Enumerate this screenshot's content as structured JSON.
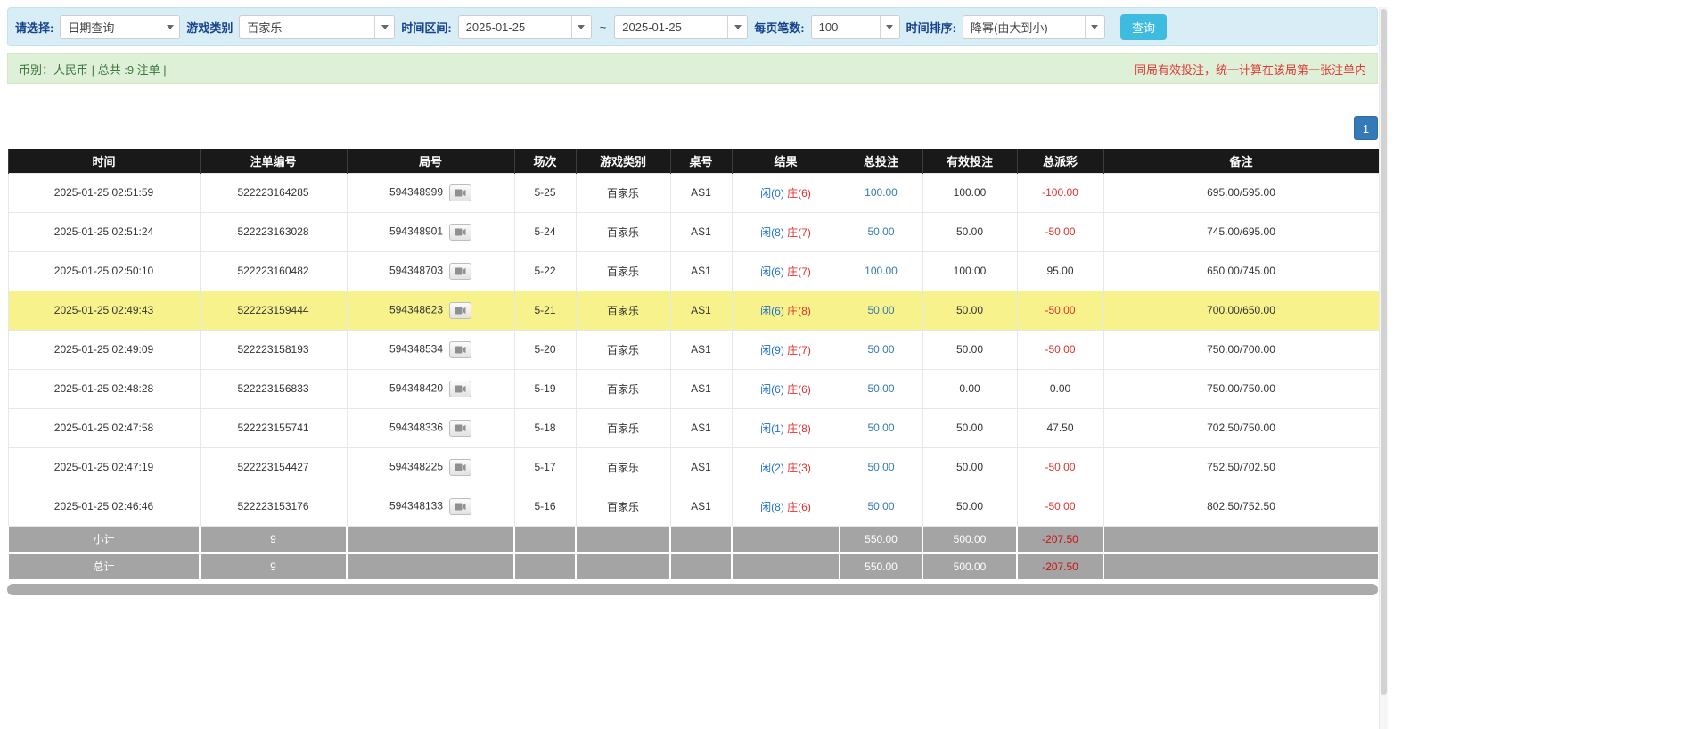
{
  "toolbar": {
    "select_label": "请选择:",
    "date_query": "日期查询",
    "game_type_label": "游戏类别",
    "game_type_value": "百家乐",
    "time_range_label": "时间区间:",
    "date_from": "2025-01-25",
    "tilde": "~",
    "date_to": "2025-01-25",
    "page_size_label": "每页笔数:",
    "page_size_value": "100",
    "sort_label": "时间排序:",
    "sort_value": "降幂(由大到小)",
    "search_button": "查询"
  },
  "summary": {
    "left": "币别：人民币 | 总共 :9 注单 |",
    "right": "同局有效投注，统一计算在该局第一张注单内"
  },
  "pagination": {
    "page": "1"
  },
  "table": {
    "headers": [
      "时间",
      "注单编号",
      "局号",
      "场次",
      "游戏类别",
      "桌号",
      "结果",
      "总投注",
      "有效投注",
      "总派彩",
      "备注"
    ],
    "rows": [
      {
        "time": "2025-01-25 02:51:59",
        "bet_id": "522223164285",
        "round_id": "594348999",
        "session": "5-25",
        "game_type": "百家乐",
        "table_no": "AS1",
        "result_player": "闲(0)",
        "result_banker": "庄(6)",
        "total_bet": "100.00",
        "valid_bet": "100.00",
        "payout": "-100.00",
        "note": "695.00/595.00",
        "highlight": false
      },
      {
        "time": "2025-01-25 02:51:24",
        "bet_id": "522223163028",
        "round_id": "594348901",
        "session": "5-24",
        "game_type": "百家乐",
        "table_no": "AS1",
        "result_player": "闲(8)",
        "result_banker": "庄(7)",
        "total_bet": "50.00",
        "valid_bet": "50.00",
        "payout": "-50.00",
        "note": "745.00/695.00",
        "highlight": false
      },
      {
        "time": "2025-01-25 02:50:10",
        "bet_id": "522223160482",
        "round_id": "594348703",
        "session": "5-22",
        "game_type": "百家乐",
        "table_no": "AS1",
        "result_player": "闲(6)",
        "result_banker": "庄(7)",
        "total_bet": "100.00",
        "valid_bet": "100.00",
        "payout": "95.00",
        "note": "650.00/745.00",
        "highlight": false
      },
      {
        "time": "2025-01-25 02:49:43",
        "bet_id": "522223159444",
        "round_id": "594348623",
        "session": "5-21",
        "game_type": "百家乐",
        "table_no": "AS1",
        "result_player": "闲(6)",
        "result_banker": "庄(8)",
        "total_bet": "50.00",
        "valid_bet": "50.00",
        "payout": "-50.00",
        "note": "700.00/650.00",
        "highlight": true
      },
      {
        "time": "2025-01-25 02:49:09",
        "bet_id": "522223158193",
        "round_id": "594348534",
        "session": "5-20",
        "game_type": "百家乐",
        "table_no": "AS1",
        "result_player": "闲(9)",
        "result_banker": "庄(7)",
        "total_bet": "50.00",
        "valid_bet": "50.00",
        "payout": "-50.00",
        "note": "750.00/700.00",
        "highlight": false
      },
      {
        "time": "2025-01-25 02:48:28",
        "bet_id": "522223156833",
        "round_id": "594348420",
        "session": "5-19",
        "game_type": "百家乐",
        "table_no": "AS1",
        "result_player": "闲(6)",
        "result_banker": "庄(6)",
        "total_bet": "50.00",
        "valid_bet": "0.00",
        "payout": "0.00",
        "note": "750.00/750.00",
        "highlight": false
      },
      {
        "time": "2025-01-25 02:47:58",
        "bet_id": "522223155741",
        "round_id": "594348336",
        "session": "5-18",
        "game_type": "百家乐",
        "table_no": "AS1",
        "result_player": "闲(1)",
        "result_banker": "庄(8)",
        "total_bet": "50.00",
        "valid_bet": "50.00",
        "payout": "47.50",
        "note": "702.50/750.00",
        "highlight": false
      },
      {
        "time": "2025-01-25 02:47:19",
        "bet_id": "522223154427",
        "round_id": "594348225",
        "session": "5-17",
        "game_type": "百家乐",
        "table_no": "AS1",
        "result_player": "闲(2)",
        "result_banker": "庄(3)",
        "total_bet": "50.00",
        "valid_bet": "50.00",
        "payout": "-50.00",
        "note": "752.50/702.50",
        "highlight": false
      },
      {
        "time": "2025-01-25 02:46:46",
        "bet_id": "522223153176",
        "round_id": "594348133",
        "session": "5-16",
        "game_type": "百家乐",
        "table_no": "AS1",
        "result_player": "闲(8)",
        "result_banker": "庄(6)",
        "total_bet": "50.00",
        "valid_bet": "50.00",
        "payout": "-50.00",
        "note": "802.50/752.50",
        "highlight": false
      }
    ],
    "subtotal": {
      "label": "小计",
      "count": "9",
      "total_bet": "550.00",
      "valid_bet": "500.00",
      "payout": "-207.50"
    },
    "total": {
      "label": "总计",
      "count": "9",
      "total_bet": "550.00",
      "valid_bet": "500.00",
      "payout": "-207.50"
    }
  },
  "colors": {
    "toolbar_bg": "#d9edf7",
    "summary_bg": "#dff0d8",
    "accent_cyan": "#3dbcdf",
    "pagination_blue": "#337ab7",
    "header_bg": "#191919",
    "highlight_row": "#f7f28b",
    "link_blue": "#337ab7",
    "player_blue": "#1f6fd0",
    "banker_red": "#e0322e",
    "negative_red": "#e0322e",
    "footer_bg": "#a4a4a4",
    "warning_red": "#e03a35"
  }
}
